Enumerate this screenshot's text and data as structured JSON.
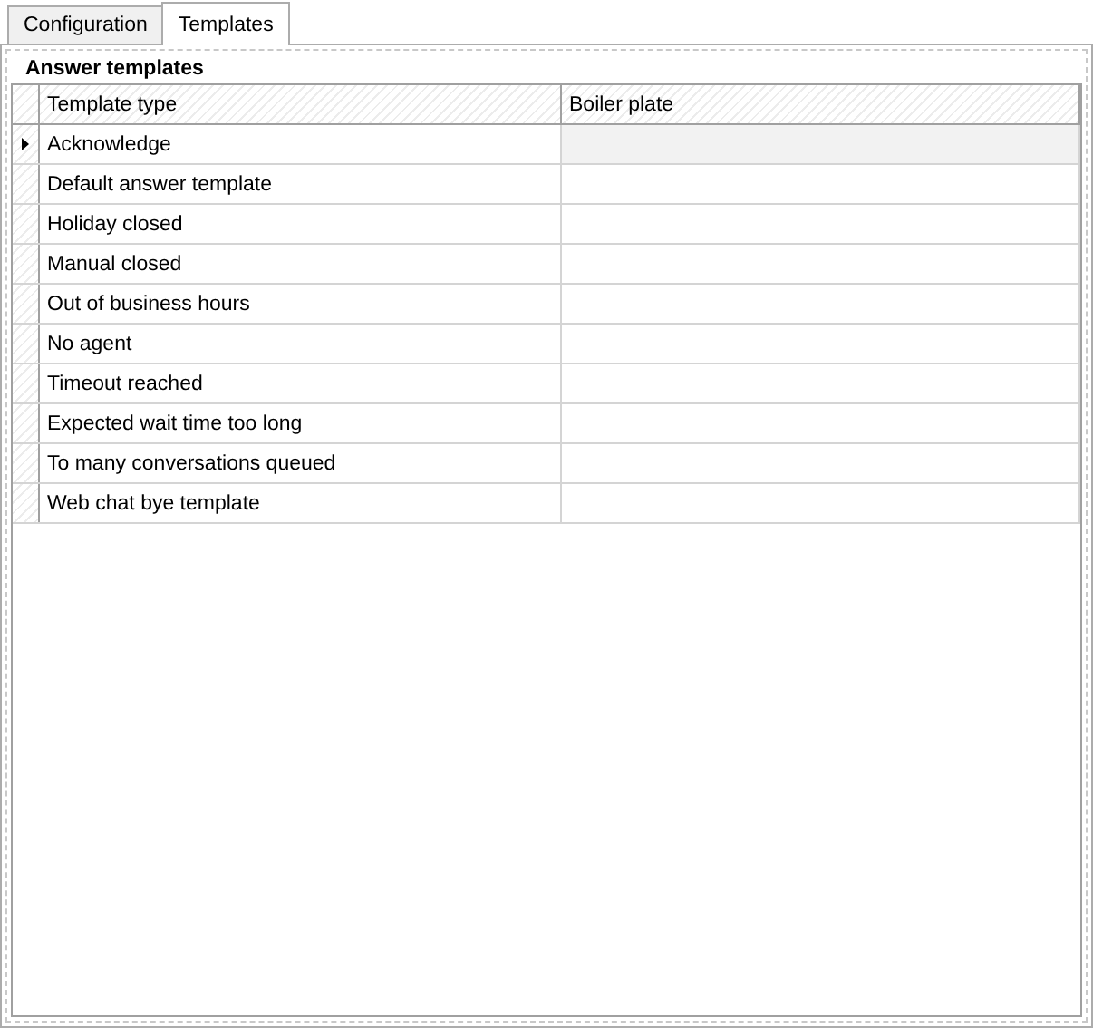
{
  "tabs": [
    {
      "label": "Configuration",
      "selected": false
    },
    {
      "label": "Templates",
      "selected": true
    }
  ],
  "group": {
    "title": "Answer templates"
  },
  "table": {
    "columns": [
      "Template type",
      "Boiler plate"
    ],
    "rows": [
      {
        "template_type": "Acknowledge",
        "selected": true
      },
      {
        "template_type": "Default answer template",
        "selected": false
      },
      {
        "template_type": "Holiday closed",
        "selected": false
      },
      {
        "template_type": "Manual closed",
        "selected": false
      },
      {
        "template_type": "Out of business hours",
        "selected": false
      },
      {
        "template_type": "No agent",
        "selected": false
      },
      {
        "template_type": "Timeout reached",
        "selected": false
      },
      {
        "template_type": "Expected wait time too long",
        "selected": false
      },
      {
        "template_type": "To many conversations queued",
        "selected": false
      },
      {
        "template_type": "Web chat bye template",
        "selected": false
      }
    ]
  }
}
